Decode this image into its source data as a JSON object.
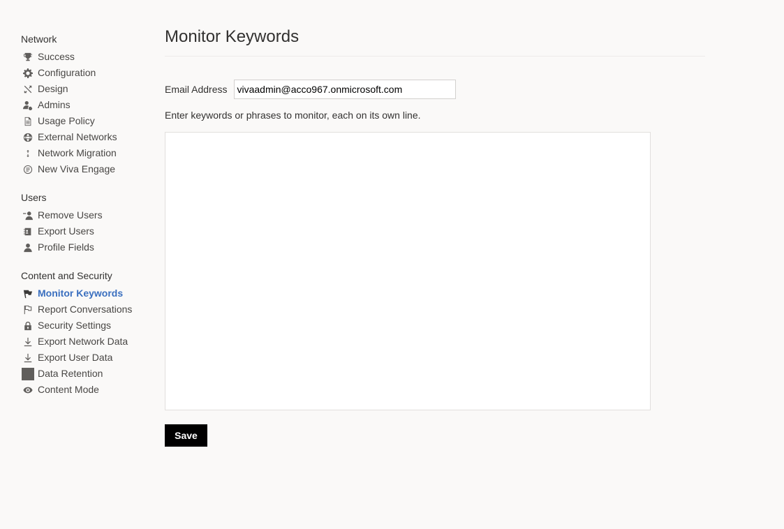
{
  "sidebar": {
    "sections": [
      {
        "title": "Network",
        "items": [
          {
            "label": "Success",
            "icon": "trophy-icon"
          },
          {
            "label": "Configuration",
            "icon": "gear-icon"
          },
          {
            "label": "Design",
            "icon": "design-icon"
          },
          {
            "label": "Admins",
            "icon": "admin-user-icon"
          },
          {
            "label": "Usage Policy",
            "icon": "document-icon"
          },
          {
            "label": "External Networks",
            "icon": "globe-icon"
          },
          {
            "label": "Network Migration",
            "icon": "migration-arrows-icon"
          },
          {
            "label": "New Viva Engage",
            "icon": "viva-engage-icon"
          }
        ]
      },
      {
        "title": "Users",
        "items": [
          {
            "label": "Remove Users",
            "icon": "remove-user-icon"
          },
          {
            "label": "Export Users",
            "icon": "contact-card-icon"
          },
          {
            "label": "Profile Fields",
            "icon": "person-icon"
          }
        ]
      },
      {
        "title": "Content and Security",
        "items": [
          {
            "label": "Monitor Keywords",
            "icon": "flag-filled-icon",
            "active": true
          },
          {
            "label": "Report Conversations",
            "icon": "flag-outline-icon"
          },
          {
            "label": "Security Settings",
            "icon": "lock-icon"
          },
          {
            "label": "Export Network Data",
            "icon": "download-icon"
          },
          {
            "label": "Export User Data",
            "icon": "download-icon"
          },
          {
            "label": "Data Retention",
            "icon": "data-retention-icon"
          },
          {
            "label": "Content Mode",
            "icon": "eye-icon"
          }
        ]
      }
    ]
  },
  "main": {
    "title": "Monitor Keywords",
    "email_label": "Email Address",
    "email_value": "vivaadmin@acco967.onmicrosoft.com",
    "instructions": "Enter keywords or phrases to monitor, each on its own line.",
    "keywords_value": "",
    "save_label": "Save"
  },
  "colors": {
    "background": "#faf9f8",
    "active_link": "#3a6fbf",
    "save_button_bg": "#000000",
    "icon": "#605e5c"
  }
}
